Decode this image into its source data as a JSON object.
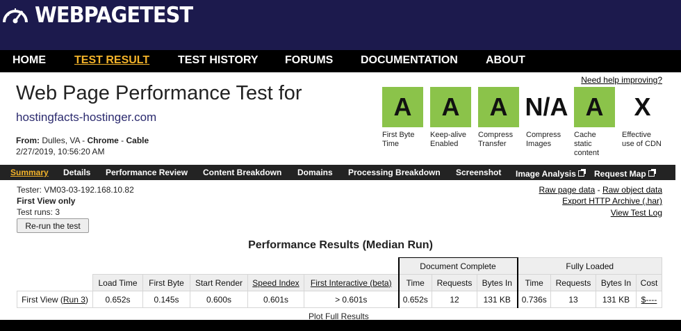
{
  "header": {
    "logo_text": "WEBPAGETEST",
    "nav": [
      "HOME",
      "TEST RESULT",
      "TEST HISTORY",
      "FORUMS",
      "DOCUMENTATION",
      "ABOUT"
    ],
    "nav_active": "TEST RESULT"
  },
  "title": "Web Page Performance Test for",
  "site_url": "hostingfacts-hostinger.com",
  "from": {
    "label": "From:",
    "location": "Dulles, VA",
    "sep1": " - ",
    "browser": "Chrome",
    "sep2": " - ",
    "connection": "Cable"
  },
  "date": "2/27/2019, 10:56:20 AM",
  "help_link": "Need help improving?",
  "grades": [
    {
      "grade": "A",
      "label": "First Byte Time",
      "color": "#8bc34a"
    },
    {
      "grade": "A",
      "label": "Keep-alive Enabled",
      "color": "#8bc34a"
    },
    {
      "grade": "A",
      "label": "Compress Transfer",
      "color": "#8bc34a"
    },
    {
      "grade": "N/A",
      "label": "Compress Images",
      "color": "#ffffff"
    },
    {
      "grade": "A",
      "label": "Cache static content",
      "color": "#8bc34a"
    },
    {
      "grade": "X",
      "label": "Effective use of CDN",
      "color": "#ffffff"
    }
  ],
  "subnav": [
    {
      "label": "Summary",
      "active": true,
      "external": false
    },
    {
      "label": "Details",
      "active": false,
      "external": false
    },
    {
      "label": "Performance Review",
      "active": false,
      "external": false
    },
    {
      "label": "Content Breakdown",
      "active": false,
      "external": false
    },
    {
      "label": "Domains",
      "active": false,
      "external": false
    },
    {
      "label": "Processing Breakdown",
      "active": false,
      "external": false
    },
    {
      "label": "Screenshot",
      "active": false,
      "external": false
    },
    {
      "label": "Image Analysis",
      "active": false,
      "external": true
    },
    {
      "label": "Request Map",
      "active": false,
      "external": true
    }
  ],
  "tester": "Tester: VM03-03-192.168.10.82",
  "first_view_only": "First View only",
  "test_runs": "Test runs: 3",
  "rerun_button": "Re-run the test",
  "links": {
    "raw_page": "Raw page data",
    "sep": " - ",
    "raw_object": "Raw object data",
    "export": "Export HTTP Archive (.har)",
    "log": "View Test Log"
  },
  "results_title": "Performance Results (Median Run)",
  "table": {
    "group_doc": "Document Complete",
    "group_full": "Fully Loaded",
    "headers": [
      "Load Time",
      "First Byte",
      "Start Render",
      "Speed Index",
      "First Interactive (beta)",
      "Time",
      "Requests",
      "Bytes In",
      "Time",
      "Requests",
      "Bytes In",
      "Cost"
    ],
    "row": {
      "label": "First View (",
      "run_link": "Run 3",
      "label_end": ")",
      "values": [
        "0.652s",
        "0.145s",
        "0.600s",
        "0.601s",
        "> 0.601s",
        "0.652s",
        "12",
        "131 KB",
        "0.736s",
        "13",
        "131 KB",
        "$----"
      ]
    }
  },
  "plot_link": "Plot Full Results"
}
